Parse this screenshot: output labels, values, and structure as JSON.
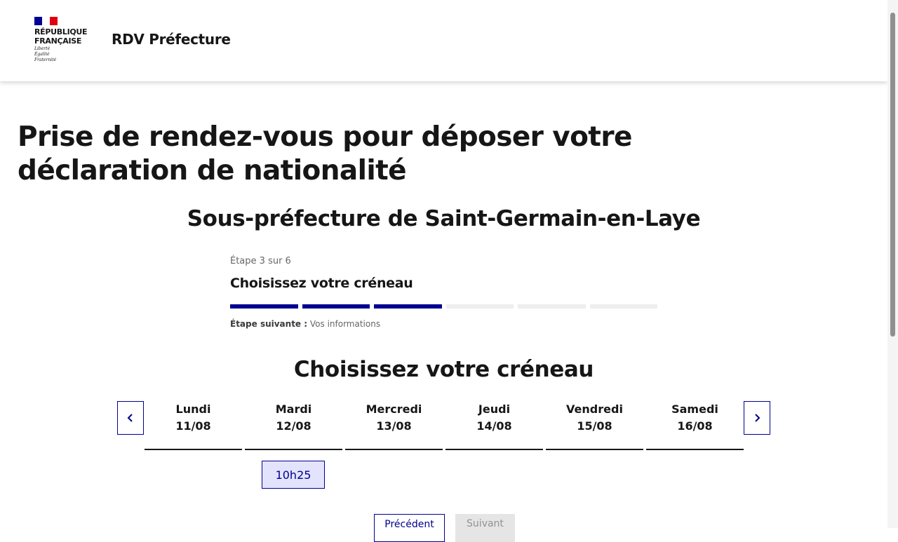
{
  "header": {
    "logo_line1": "RÉPUBLIQUE",
    "logo_line2": "FRANÇAISE",
    "motto": [
      "Liberté",
      "Égalité",
      "Fraternité"
    ],
    "service_title": "RDV Préfecture"
  },
  "page_title": "Prise de rendez-vous pour déposer votre déclaration de nationalité",
  "subtitle": "Sous-préfecture de Saint-Germain-en-Laye",
  "stepper": {
    "state": "Étape 3 sur 6",
    "current_step": 3,
    "total_steps": 6,
    "title": "Choisissez votre créneau",
    "next_label": "Étape suivante :",
    "next_value": "Vos informations"
  },
  "slots_section": {
    "title": "Choisissez votre créneau",
    "days": [
      {
        "name": "Lundi",
        "date": "11/08"
      },
      {
        "name": "Mardi",
        "date": "12/08"
      },
      {
        "name": "Mercredi",
        "date": "13/08"
      },
      {
        "name": "Jeudi",
        "date": "14/08"
      },
      {
        "name": "Vendredi",
        "date": "15/08"
      },
      {
        "name": "Samedi",
        "date": "16/08"
      }
    ],
    "slots": [
      {
        "day": "12/08",
        "time": "10h25"
      }
    ]
  },
  "buttons": {
    "previous": "Précédent",
    "next": "Suivant"
  },
  "colors": {
    "primary_blue": "#000091",
    "flag_red": "#e1000f",
    "slot_background": "#e3e3fd",
    "disabled_background": "#e5e5e5"
  },
  "icons": {
    "calendar_prev": "chevron-left-icon",
    "calendar_next": "chevron-right-icon"
  }
}
